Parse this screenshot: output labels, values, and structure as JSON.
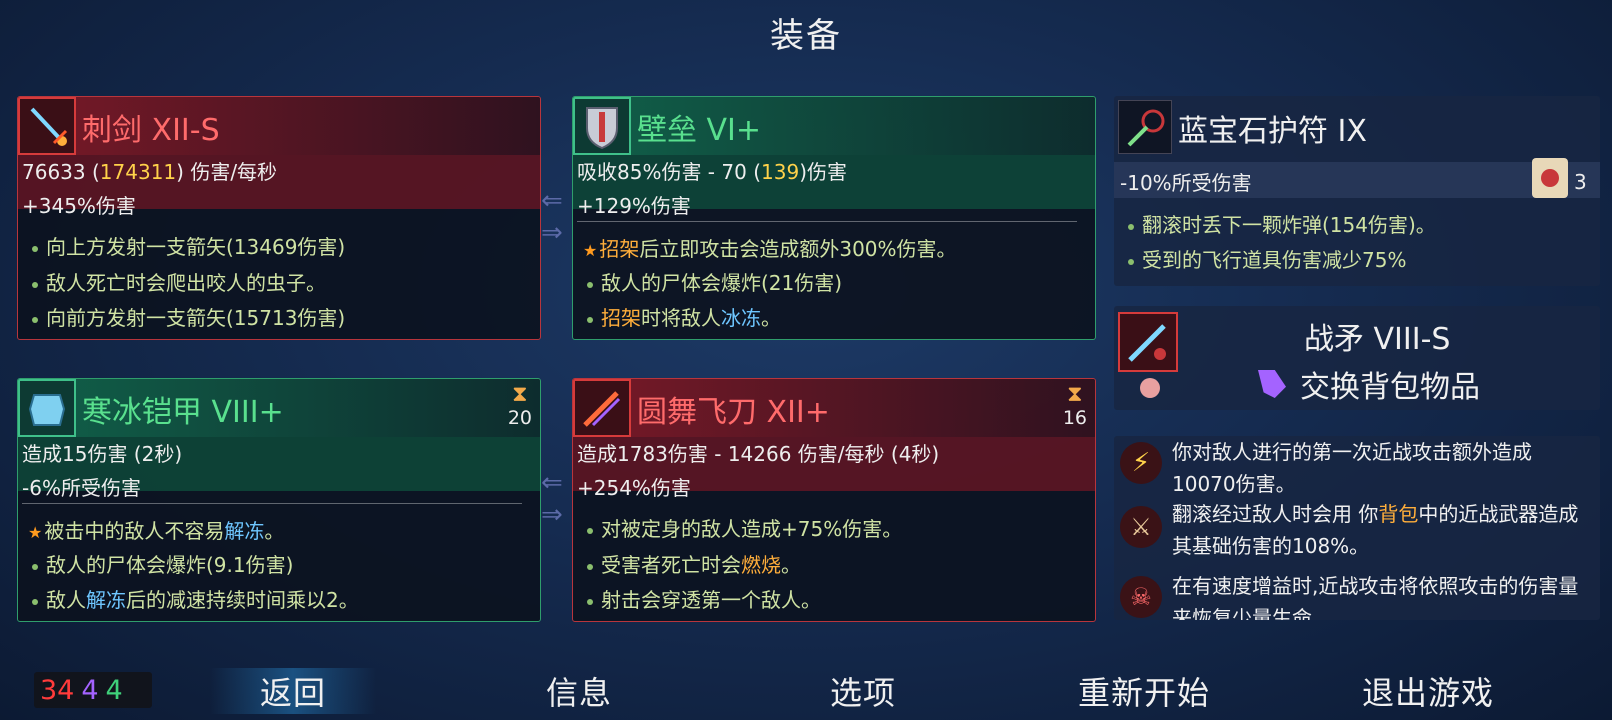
{
  "header": {
    "title": "装备"
  },
  "weapon1": {
    "name": "刺剑 XII-S",
    "dps_base": "76633 (",
    "dps_hl": "174311",
    "dps_tail": ") 伤害/每秒",
    "bonus": "+345%伤害",
    "perks": [
      "向上方发射一支箭矢(13469伤害)",
      "敌人死亡时会爬出咬人的虫子。",
      "向前方发射一支箭矢(15713伤害)"
    ]
  },
  "weapon2": {
    "name": "壁垒 VI+",
    "stat_pre": "吸收85%伤害 - 70 (",
    "stat_hl": "139",
    "stat_tail": ")伤害",
    "bonus": "+129%伤害",
    "perk_star_a": "招架",
    "perk_star_b": "后立即攻击会造成额外300%伤害。",
    "perk2": "敌人的尸体会爆炸(21伤害)",
    "perk3_a": "招架",
    "perk3_b": "时将敌人",
    "perk3_c": "冰冻",
    "perk3_d": "。"
  },
  "amulet": {
    "name": "蓝宝石护符 IX",
    "stat": "-10%所受伤害",
    "count": "3",
    "perk1": "翻滚时丢下一颗炸弹(154伤害)。",
    "perk2": "受到的飞行道具伤害减少75%"
  },
  "skill1": {
    "name": "寒冰铠甲 VIII+",
    "cooldown": "20",
    "stat": "造成15伤害 (2秒)",
    "bonus": "-6%所受伤害",
    "perk_star_a": "被击中的敌人不容易",
    "perk_star_b": "解冻",
    "perk_star_c": "。",
    "perk2": "敌人的尸体会爆炸(9.1伤害)",
    "perk3_a": "敌人",
    "perk3_b": "解冻",
    "perk3_c": "后的减速持续时间乘以2。"
  },
  "skill2": {
    "name": "圆舞飞刀 XII+",
    "cooldown": "16",
    "stat": "造成1783伤害 - 14266 伤害/每秒 (4秒)",
    "bonus": "+254%伤害",
    "perk1": "对被定身的敌人造成+75%伤害。",
    "perk2_a": "受害者死亡时会",
    "perk2_b": "燃烧",
    "perk2_c": "。",
    "perk3": "射击会穿透第一个敌人。"
  },
  "backpack": {
    "name": "战矛 VIII-S",
    "action": "交换背包物品"
  },
  "mutations": {
    "m1": "你对敌人进行的第一次近战攻击额外造成10070伤害。",
    "m2_a": "翻滚经过敌人时会用 你",
    "m2_b": "背包",
    "m2_c": "中的近战武器造成其基础伤害的108%。",
    "m3": "在有速度增益时,近战攻击将依照攻击的伤害量来恢复少量生命。"
  },
  "scrolls": {
    "brutality": "34",
    "tactics": "4",
    "survival": "4"
  },
  "colors": {
    "brutality": "#ff3b3b",
    "tactics": "#a463ff",
    "survival": "#3fd07a"
  },
  "menu": {
    "back": "返回",
    "info": "信息",
    "options": "选项",
    "restart": "重新开始",
    "quit": "退出游戏"
  }
}
